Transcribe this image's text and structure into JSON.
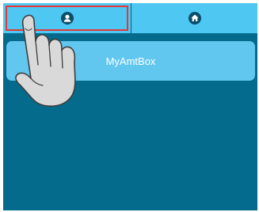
{
  "tabs": [
    {
      "icon": "user-icon",
      "selected": true
    },
    {
      "icon": "home-icon",
      "selected": false
    }
  ],
  "list": {
    "items": [
      {
        "label": "MyAmtBox"
      }
    ]
  },
  "overlay": {
    "icon": "pointing-hand-icon",
    "highlight_color": "#e43838"
  },
  "colors": {
    "tabbar": "#4ec7f2",
    "background": "#056b8c",
    "list_item": "#62c7ef",
    "icon_fill": "#0a4e6a"
  }
}
